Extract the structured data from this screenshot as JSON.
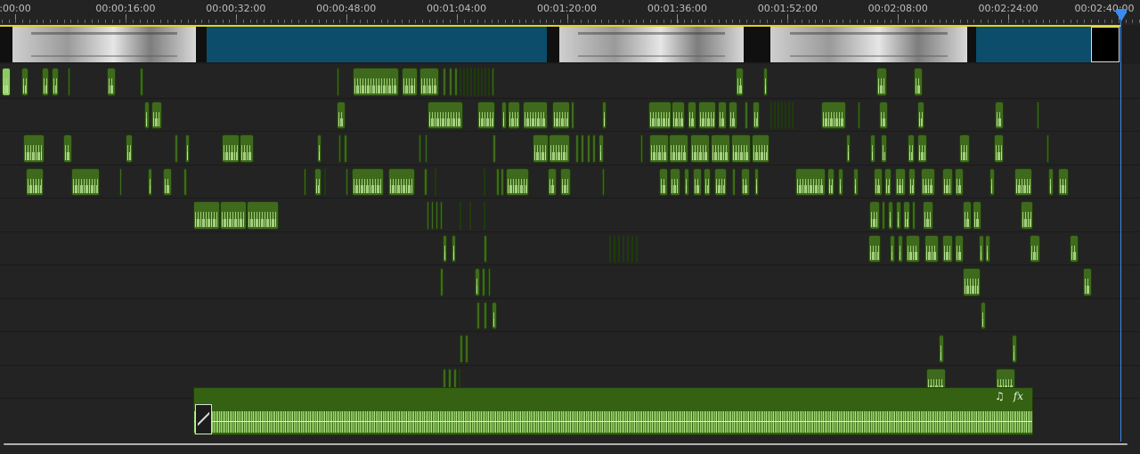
{
  "ruler": {
    "timecodes": [
      ":00:00",
      "00:00:16:00",
      "00:00:32:00",
      "00:00:48:00",
      "00:01:04:00",
      "00:01:20:00",
      "00:01:36:00",
      "00:01:52:00",
      "00:02:08:00",
      "00:02:24:00",
      "00:02:40:00"
    ]
  },
  "video_track": {
    "clips": [
      {
        "kind": "thumb"
      },
      {
        "kind": "blue"
      },
      {
        "kind": "thumb"
      },
      {
        "kind": "thumb"
      },
      {
        "kind": "blue"
      },
      {
        "kind": "black"
      }
    ]
  },
  "music_clip": {
    "icons": [
      "music-note-icon",
      "fx-icon"
    ],
    "note_glyph": "♫",
    "fx_glyph": "fx"
  },
  "colors": {
    "clip_green": "#3f6a1e",
    "waveform": "#a6d97a",
    "video_blue": "#0b4d6b",
    "playhead": "#3a8bf0",
    "video_track_line": "#e2d21a"
  }
}
